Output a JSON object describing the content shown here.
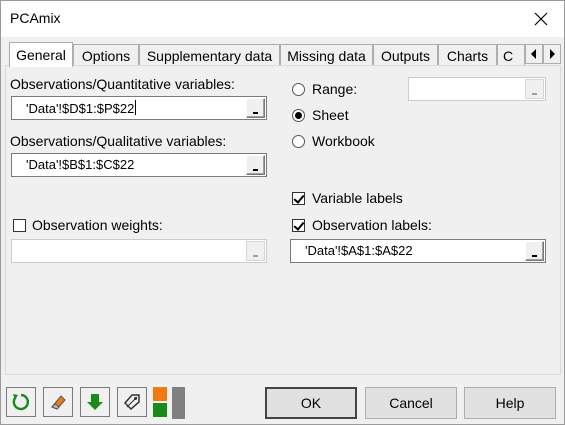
{
  "window": {
    "title": "PCAmix"
  },
  "tabs": [
    {
      "label": "General"
    },
    {
      "label": "Options"
    },
    {
      "label": "Supplementary data"
    },
    {
      "label": "Missing data"
    },
    {
      "label": "Outputs"
    },
    {
      "label": "Charts"
    },
    {
      "label": "C"
    }
  ],
  "general": {
    "quant_label": "Observations/Quantitative variables:",
    "quant_value": "'Data'!$D$1:$P$22",
    "qual_label": "Observations/Qualitative variables:",
    "qual_value": "'Data'!$B$1:$C$22",
    "weights_label": "Observation weights:",
    "weights_value": "",
    "range_label": "Range:",
    "range_value": "",
    "sheet_label": "Sheet",
    "workbook_label": "Workbook",
    "variable_labels_label": "Variable labels",
    "observation_labels_label": "Observation labels:",
    "observation_labels_value": "'Data'!$A$1:$A$22"
  },
  "state": {
    "output_selected": "Sheet",
    "variable_labels_checked": true,
    "observation_labels_checked": true,
    "observation_weights_checked": false
  },
  "buttons": {
    "ok": "OK",
    "cancel": "Cancel",
    "help": "Help"
  },
  "colors": {
    "green": "#1a8a1a",
    "orange": "#f07a10",
    "gray": "#808080"
  }
}
